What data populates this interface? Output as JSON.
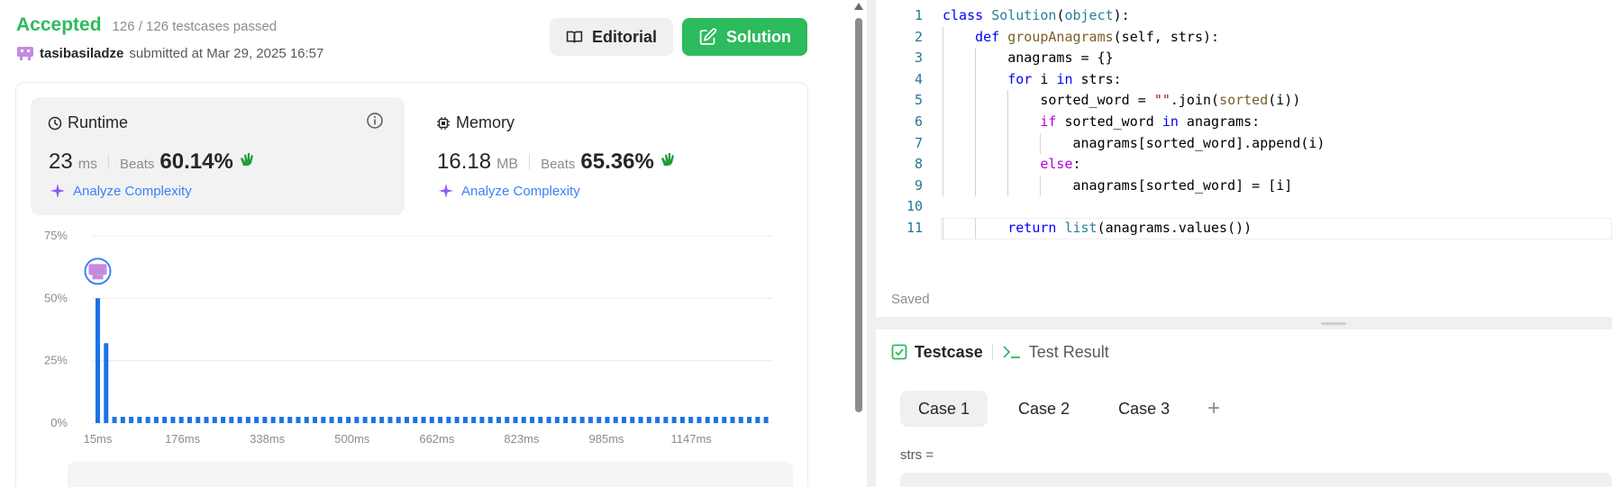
{
  "submission": {
    "status": "Accepted",
    "testcases": "126 / 126 testcases passed",
    "username": "tasibasiladze",
    "submitted_text": "submitted at Mar 29, 2025 16:57"
  },
  "buttons": {
    "editorial": "Editorial",
    "solution": "Solution"
  },
  "runtime": {
    "title": "Runtime",
    "value": "23",
    "unit": "ms",
    "beats_label": "Beats",
    "beats": "60.14%",
    "analyze": "Analyze Complexity"
  },
  "memory": {
    "title": "Memory",
    "value": "16.18",
    "unit": "MB",
    "beats_label": "Beats",
    "beats": "65.36%",
    "analyze": "Analyze Complexity"
  },
  "colors": {
    "accepted": "#2cbb5d",
    "bar": "#1a73e8",
    "link": "#3b82f6"
  },
  "chart_data": {
    "type": "bar",
    "xlabel": "",
    "ylabel": "",
    "ylim": [
      0,
      75
    ],
    "y_ticks": [
      "0%",
      "25%",
      "50%",
      "75%"
    ],
    "y_tick_values": [
      0,
      25,
      50,
      75
    ],
    "x_tick_labels": [
      "15ms",
      "176ms",
      "338ms",
      "500ms",
      "662ms",
      "823ms",
      "985ms",
      "1147ms"
    ],
    "values": [
      50,
      32,
      2.5,
      2.5,
      2.5,
      2.5,
      2.5,
      2.5,
      2.5,
      2.5,
      2.5,
      2.5,
      2.5,
      2.5,
      2.5,
      2.5,
      2.5,
      2.5,
      2.5,
      2.5,
      2.5,
      2.5,
      2.5,
      2.5,
      2.5,
      2.5,
      2.5,
      2.5,
      2.5,
      2.5,
      2.5,
      2.5,
      2.5,
      2.5,
      2.5,
      2.5,
      2.5,
      2.5,
      2.5,
      2.5,
      2.5,
      2.5,
      2.5,
      2.5,
      2.5,
      2.5,
      2.5,
      2.5,
      2.5,
      2.5,
      2.5,
      2.5,
      2.5,
      2.5,
      2.5,
      2.5,
      2.5,
      2.5,
      2.5,
      2.5,
      2.5,
      2.5,
      2.5,
      2.5,
      2.5,
      2.5,
      2.5,
      2.5,
      2.5,
      2.5,
      2.5,
      2.5,
      2.5,
      2.5,
      2.5,
      2.5,
      2.5,
      2.5,
      2.5,
      2.5,
      2.5
    ],
    "highlight_index": 0,
    "grid": true
  },
  "code": {
    "lines": [
      "class Solution(object):",
      "    def groupAnagrams(self, strs):",
      "        anagrams = {}",
      "        for i in strs:",
      "            sorted_word = \"\".join(sorted(i))",
      "            if sorted_word in anagrams:",
      "                anagrams[sorted_word].append(i)",
      "            else:",
      "                anagrams[sorted_word] = [i]",
      "",
      "        return list(anagrams.values())"
    ],
    "saved": "Saved"
  },
  "bottom": {
    "tab_testcase": "Testcase",
    "tab_result": "Test Result",
    "cases": [
      "Case 1",
      "Case 2",
      "Case 3"
    ],
    "add": "+",
    "param_label": "strs ="
  }
}
